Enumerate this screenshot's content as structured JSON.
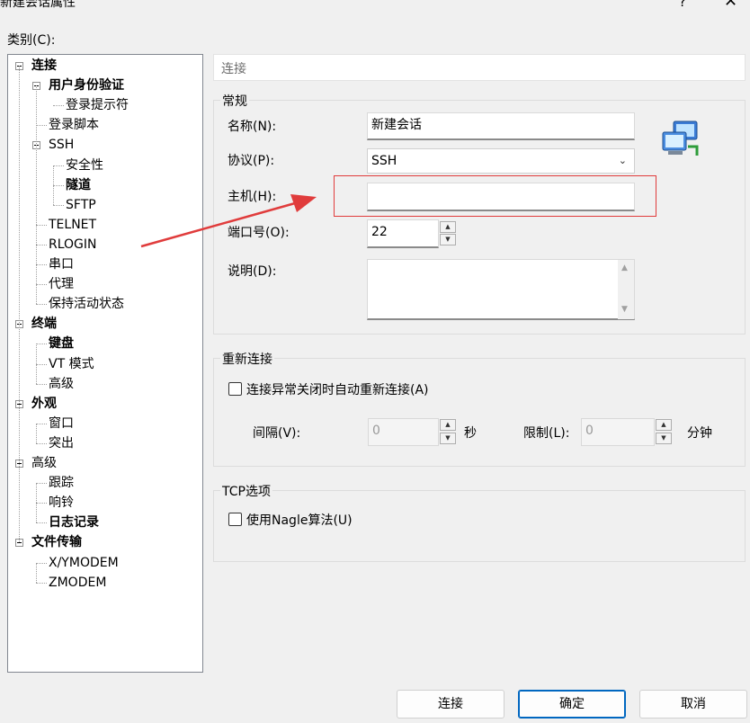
{
  "window": {
    "title": "新建会话属性",
    "help_glyph": "?",
    "close_glyph": "✕"
  },
  "category_label": "类别(C):",
  "tree": [
    {
      "label": "连接",
      "bold": true,
      "expander": true,
      "level": 0
    },
    {
      "label": "用户身份验证",
      "bold": true,
      "expander": true,
      "level": 1
    },
    {
      "label": "登录提示符",
      "bold": false,
      "expander": false,
      "level": 2
    },
    {
      "label": "登录脚本",
      "bold": false,
      "expander": false,
      "level": 1
    },
    {
      "label": "SSH",
      "bold": false,
      "expander": true,
      "level": 1
    },
    {
      "label": "安全性",
      "bold": false,
      "expander": false,
      "level": 2
    },
    {
      "label": "隧道",
      "bold": true,
      "expander": false,
      "level": 2
    },
    {
      "label": "SFTP",
      "bold": false,
      "expander": false,
      "level": 2
    },
    {
      "label": "TELNET",
      "bold": false,
      "expander": false,
      "level": 1
    },
    {
      "label": "RLOGIN",
      "bold": false,
      "expander": false,
      "level": 1
    },
    {
      "label": "串口",
      "bold": false,
      "expander": false,
      "level": 1
    },
    {
      "label": "代理",
      "bold": false,
      "expander": false,
      "level": 1
    },
    {
      "label": "保持活动状态",
      "bold": false,
      "expander": false,
      "level": 1
    },
    {
      "label": "终端",
      "bold": true,
      "expander": true,
      "level": 0
    },
    {
      "label": "键盘",
      "bold": true,
      "expander": false,
      "level": 1
    },
    {
      "label": "VT 模式",
      "bold": false,
      "expander": false,
      "level": 1
    },
    {
      "label": "高级",
      "bold": false,
      "expander": false,
      "level": 1
    },
    {
      "label": "外观",
      "bold": true,
      "expander": true,
      "level": 0
    },
    {
      "label": "窗口",
      "bold": false,
      "expander": false,
      "level": 1
    },
    {
      "label": "突出",
      "bold": false,
      "expander": false,
      "level": 1
    },
    {
      "label": "高级",
      "bold": false,
      "expander": true,
      "level": 0
    },
    {
      "label": "跟踪",
      "bold": false,
      "expander": false,
      "level": 1
    },
    {
      "label": "响铃",
      "bold": false,
      "expander": false,
      "level": 1
    },
    {
      "label": "日志记录",
      "bold": true,
      "expander": false,
      "level": 1
    },
    {
      "label": "文件传输",
      "bold": true,
      "expander": true,
      "level": 0
    },
    {
      "label": "X/YMODEM",
      "bold": false,
      "expander": false,
      "level": 1
    },
    {
      "label": "ZMODEM",
      "bold": false,
      "expander": false,
      "level": 1
    }
  ],
  "panel": {
    "header": "连接",
    "general": {
      "title": "常规",
      "name_label": "名称(N):",
      "name_value": "新建会话",
      "protocol_label": "协议(P):",
      "protocol_value": "SSH",
      "host_label": "主机(H):",
      "host_value": "",
      "port_label": "端口号(O):",
      "port_value": "22",
      "desc_label": "说明(D):",
      "desc_value": ""
    },
    "reconnect": {
      "title": "重新连接",
      "checkbox_label": "连接异常关闭时自动重新连接(A)",
      "interval_label": "间隔(V):",
      "interval_value": "0",
      "interval_unit": "秒",
      "limit_label": "限制(L):",
      "limit_value": "0",
      "limit_unit": "分钟"
    },
    "tcp": {
      "title": "TCP选项",
      "checkbox_label": "使用Nagle算法(U)"
    }
  },
  "buttons": {
    "connect": "连接",
    "ok": "确定",
    "cancel": "取消"
  },
  "colors": {
    "annotation_red": "#e03c3c",
    "primary_border": "#0067c0"
  },
  "icons": {
    "session_icon": "network-computers-icon"
  }
}
